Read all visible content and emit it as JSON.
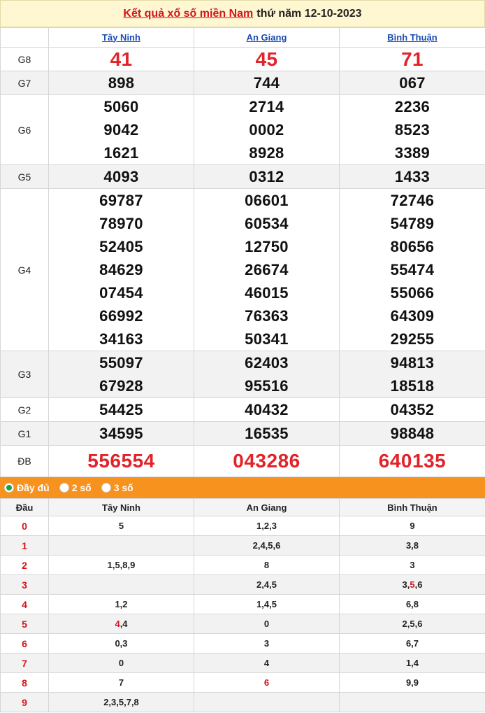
{
  "title": {
    "link": "Kết quả xổ số miền Nam",
    "date": "thứ năm 12-10-2023"
  },
  "provinces": [
    "Tây Ninh",
    "An Giang",
    "Bình Thuận"
  ],
  "prizes": [
    {
      "label": "G8",
      "values": [
        [
          "41"
        ],
        [
          "45"
        ],
        [
          "71"
        ]
      ]
    },
    {
      "label": "G7",
      "values": [
        [
          "898"
        ],
        [
          "744"
        ],
        [
          "067"
        ]
      ]
    },
    {
      "label": "G6",
      "values": [
        [
          "5060",
          "9042",
          "1621"
        ],
        [
          "2714",
          "0002",
          "8928"
        ],
        [
          "2236",
          "8523",
          "3389"
        ]
      ]
    },
    {
      "label": "G5",
      "values": [
        [
          "4093"
        ],
        [
          "0312"
        ],
        [
          "1433"
        ]
      ]
    },
    {
      "label": "G4",
      "values": [
        [
          "69787",
          "78970",
          "52405",
          "84629",
          "07454",
          "66992",
          "34163"
        ],
        [
          "06601",
          "60534",
          "12750",
          "26674",
          "46015",
          "76363",
          "50341"
        ],
        [
          "72746",
          "54789",
          "80656",
          "55474",
          "55066",
          "64309",
          "29255"
        ]
      ]
    },
    {
      "label": "G3",
      "values": [
        [
          "55097",
          "67928"
        ],
        [
          "62403",
          "95516"
        ],
        [
          "94813",
          "18518"
        ]
      ]
    },
    {
      "label": "G2",
      "values": [
        [
          "54425"
        ],
        [
          "40432"
        ],
        [
          "04352"
        ]
      ]
    },
    {
      "label": "G1",
      "values": [
        [
          "34595"
        ],
        [
          "16535"
        ],
        [
          "98848"
        ]
      ]
    },
    {
      "label": "ĐB",
      "values": [
        [
          "556554"
        ],
        [
          "043286"
        ],
        [
          "640135"
        ]
      ]
    }
  ],
  "options": [
    {
      "label": "Đầy đủ",
      "checked": true
    },
    {
      "label": "2 số",
      "checked": false
    },
    {
      "label": "3 số",
      "checked": false
    }
  ],
  "loto": {
    "header": "Đầu",
    "rows": [
      {
        "head": "0",
        "cols": [
          [
            [
              "5",
              false
            ]
          ],
          [
            [
              "1,2,3",
              false
            ]
          ],
          [
            [
              "9",
              false
            ]
          ]
        ]
      },
      {
        "head": "1",
        "cols": [
          [
            [
              "",
              false
            ]
          ],
          [
            [
              "2,4,5,6",
              false
            ]
          ],
          [
            [
              "3,8",
              false
            ]
          ]
        ]
      },
      {
        "head": "2",
        "cols": [
          [
            [
              "1,5,8,9",
              false
            ]
          ],
          [
            [
              "8",
              false
            ]
          ],
          [
            [
              "3",
              false
            ]
          ]
        ]
      },
      {
        "head": "3",
        "cols": [
          [
            [
              "",
              false
            ]
          ],
          [
            [
              "2,4,5",
              false
            ]
          ],
          [
            [
              "3,",
              false
            ],
            [
              "5",
              true
            ],
            [
              ",6",
              false
            ]
          ]
        ]
      },
      {
        "head": "4",
        "cols": [
          [
            [
              "1,2",
              false
            ]
          ],
          [
            [
              "1,4,5",
              false
            ]
          ],
          [
            [
              "6,8",
              false
            ]
          ]
        ]
      },
      {
        "head": "5",
        "cols": [
          [
            [
              "4",
              true
            ],
            [
              ",4",
              false
            ]
          ],
          [
            [
              "0",
              false
            ]
          ],
          [
            [
              "2,5,6",
              false
            ]
          ]
        ]
      },
      {
        "head": "6",
        "cols": [
          [
            [
              "0,3",
              false
            ]
          ],
          [
            [
              "3",
              false
            ]
          ],
          [
            [
              "6,7",
              false
            ]
          ]
        ]
      },
      {
        "head": "7",
        "cols": [
          [
            [
              "0",
              false
            ]
          ],
          [
            [
              "4",
              false
            ]
          ],
          [
            [
              "1,4",
              false
            ]
          ]
        ]
      },
      {
        "head": "8",
        "cols": [
          [
            [
              "7",
              false
            ]
          ],
          [
            [
              "6",
              true
            ]
          ],
          [
            [
              "9,9",
              false
            ]
          ]
        ]
      },
      {
        "head": "9",
        "cols": [
          [
            [
              "2,3,5,7,8",
              false
            ]
          ],
          [
            [
              "",
              false
            ]
          ],
          [
            [
              "",
              false
            ]
          ]
        ]
      }
    ]
  },
  "colors": {
    "accent_red": "#e0242a",
    "orange_bar": "#f7921e",
    "title_bg": "#fef7d2",
    "link_blue": "#1a4cb3"
  }
}
